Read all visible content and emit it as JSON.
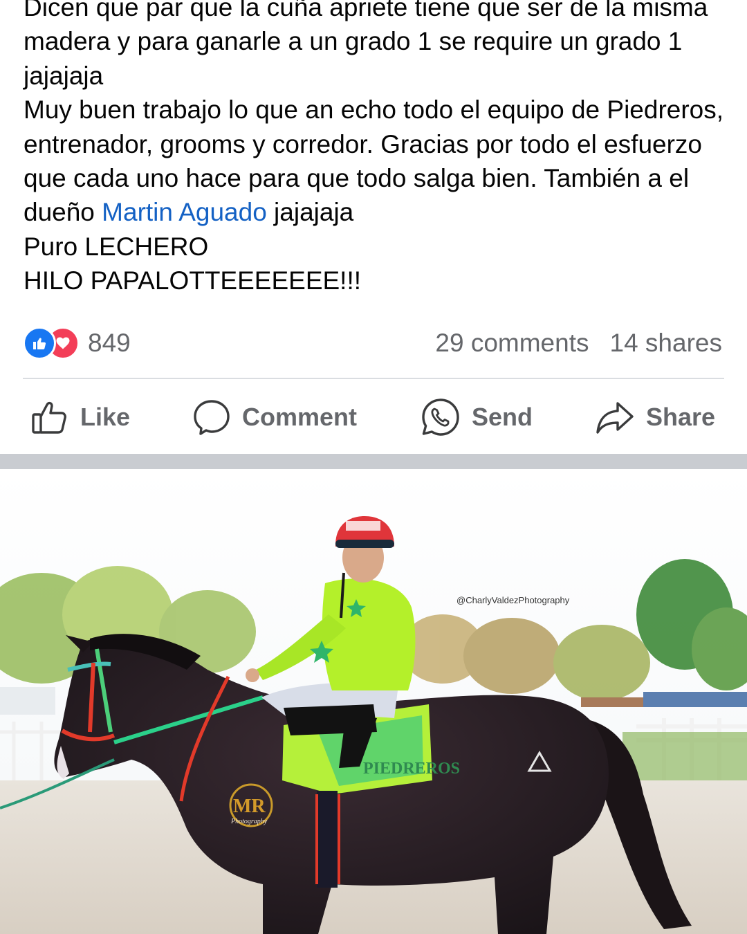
{
  "post": {
    "text_lines": [
      "Dicen que par que la cuña apriete tiene que ser de la misma madera y para ganarle a un grado 1 se require un grado 1 jajajaja",
      "Muy buen trabajo lo que an echo todo el equipo de Piedreros, entrenador, grooms y corredor. Gracias por todo el esfuerzo que cada uno hace para que todo salga bien. También a el dueño "
    ],
    "mention": "Martin Aguado",
    "after_mention": " jajajaja",
    "line_lechero": "Puro LECHERO",
    "line_hilo": "HILO PAPALOTTEEEEEEE!!!"
  },
  "stats": {
    "reactions": [
      "like-icon",
      "love-icon"
    ],
    "reaction_count": "849",
    "comments": "29 comments",
    "shares": "14 shares"
  },
  "actions": {
    "like": "Like",
    "comment": "Comment",
    "send": "Send",
    "share": "Share"
  },
  "photo": {
    "watermark": "@CharlyValdezPhotography",
    "logo_text": "MR",
    "logo_subtext": "Photography",
    "saddle_cloth_text": "PIEDREROS"
  },
  "colors": {
    "mention": "#1461c4",
    "like_blue": "#1877f2",
    "love_red": "#f33e58",
    "muted_text": "#65676b",
    "jockey_silks": "#b4f02a",
    "horse": "#2a1f24"
  }
}
